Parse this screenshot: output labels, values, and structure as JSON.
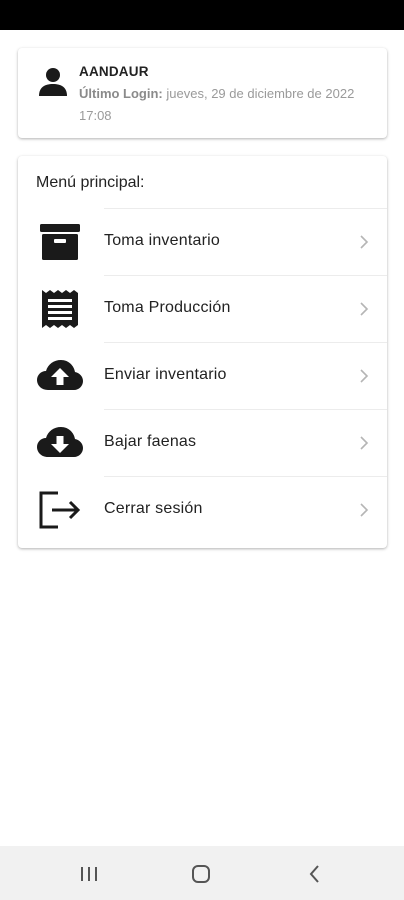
{
  "user": {
    "name": "AANDAUR",
    "last_login_label": "Último Login:",
    "last_login_value": "jueves, 29 de diciembre de 2022 17:08"
  },
  "menu": {
    "title": "Menú principal:",
    "items": [
      {
        "label": "Toma inventario",
        "icon": "archive-box-icon"
      },
      {
        "label": "Toma Producción",
        "icon": "receipt-icon"
      },
      {
        "label": "Enviar inventario",
        "icon": "cloud-upload-icon"
      },
      {
        "label": "Bajar faenas",
        "icon": "cloud-download-icon"
      },
      {
        "label": "Cerrar sesión",
        "icon": "logout-icon"
      }
    ]
  },
  "colors": {
    "status_bar": "#000000",
    "icon": "#1a1a1a",
    "chevron": "#b5b5b5",
    "secondary_text": "#9a9a9a",
    "nav_bar": "#f1f1f1"
  }
}
